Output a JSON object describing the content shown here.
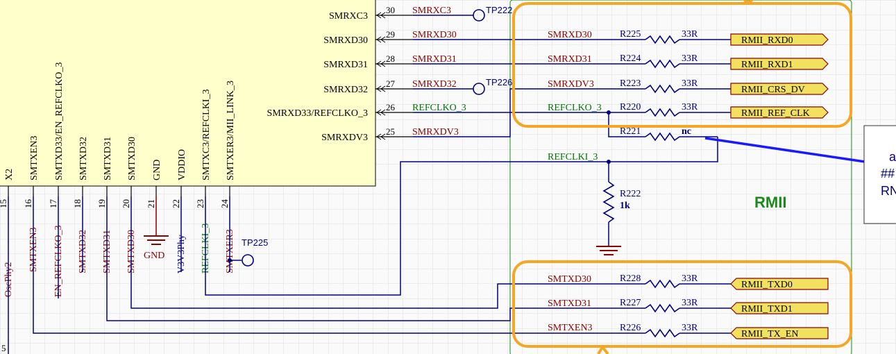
{
  "colors": {
    "background": "#fafafa",
    "grid": "#d6d6d6",
    "component_fill": "#ffffcc",
    "wire": "#000080",
    "net_label": "#8b0000",
    "net_label_green": "#007700",
    "highlight_box": "#f5a623",
    "port_fill": "#f2e05f",
    "group_outline": "#1a8a1a"
  },
  "chip": {
    "right_pins": [
      {
        "num": "30",
        "name": "SMRXC3",
        "net": "SMRXC3"
      },
      {
        "num": "29",
        "name": "SMRXD30",
        "net": "SMRXD30"
      },
      {
        "num": "28",
        "name": "SMRXD31",
        "net": "SMRXD31"
      },
      {
        "num": "27",
        "name": "SMRXD32",
        "net": "SMRXD32"
      },
      {
        "num": "26",
        "name": "SMRXD33/REFCLKO_3",
        "net": "REFCLKO_3"
      },
      {
        "num": "25",
        "name": "SMRXDV3",
        "net": "SMRXDV3"
      }
    ],
    "bottom_pins": [
      {
        "num": "15",
        "name": "X2",
        "net": "OscPhy2"
      },
      {
        "num": "16",
        "name": "SMTXEN3",
        "net": "SMTXEN3"
      },
      {
        "num": "17",
        "name": "SMTXD33/EN_REFCLKO_3",
        "net": "EN_REFCLKO_3"
      },
      {
        "num": "18",
        "name": "SMTXD32",
        "net": "SMTXD32"
      },
      {
        "num": "19",
        "name": "SMTXD31",
        "net": "SMTXD31"
      },
      {
        "num": "20",
        "name": "SMTXD30",
        "net": "SMTXD30"
      },
      {
        "num": "21",
        "name": "GND",
        "net": "GND"
      },
      {
        "num": "22",
        "name": "VDDIO",
        "net": "V3V3Phy"
      },
      {
        "num": "23",
        "name": "SMTXC3/REFCLKI_3",
        "net": "REFCLKI_3"
      },
      {
        "num": "24",
        "name": "SMTXER3/MII_LINK_3",
        "net": "SMTXER3"
      }
    ],
    "left_edge_label": "5"
  },
  "test_points": {
    "tp_rxc": "TP222",
    "tp_rxd32": "TP226",
    "tp_txer": "TP225"
  },
  "resistors": [
    {
      "net": "SMRXD30",
      "des": "R225",
      "value": "33R",
      "port": "RMII_RXD0"
    },
    {
      "net": "SMRXD31",
      "des": "R224",
      "value": "33R",
      "port": "RMII_RXD1"
    },
    {
      "net": "SMRXDV3",
      "des": "R223",
      "value": "33R",
      "port": "RMII_CRS_DV"
    },
    {
      "net": "REFCLKO_3",
      "des": "R220",
      "value": "33R",
      "port": "RMII_REF_CLK"
    },
    {
      "net": "",
      "des": "R221",
      "value": "nc",
      "port": ""
    },
    {
      "net": "SMTXD30",
      "des": "R228",
      "value": "33R",
      "port": "RMII_TXD0"
    },
    {
      "net": "SMTXD31",
      "des": "R227",
      "value": "33R",
      "port": "RMII_TXD1"
    },
    {
      "net": "SMTXEN3",
      "des": "R226",
      "value": "33R",
      "port": "RMII_TX_EN"
    }
  ],
  "refclki_net": "REFCLKI_3",
  "pulldown": {
    "des": "R222",
    "value": "1k"
  },
  "group_label": "RMII",
  "note_box_lines": [
    "a",
    "##",
    "RN"
  ]
}
